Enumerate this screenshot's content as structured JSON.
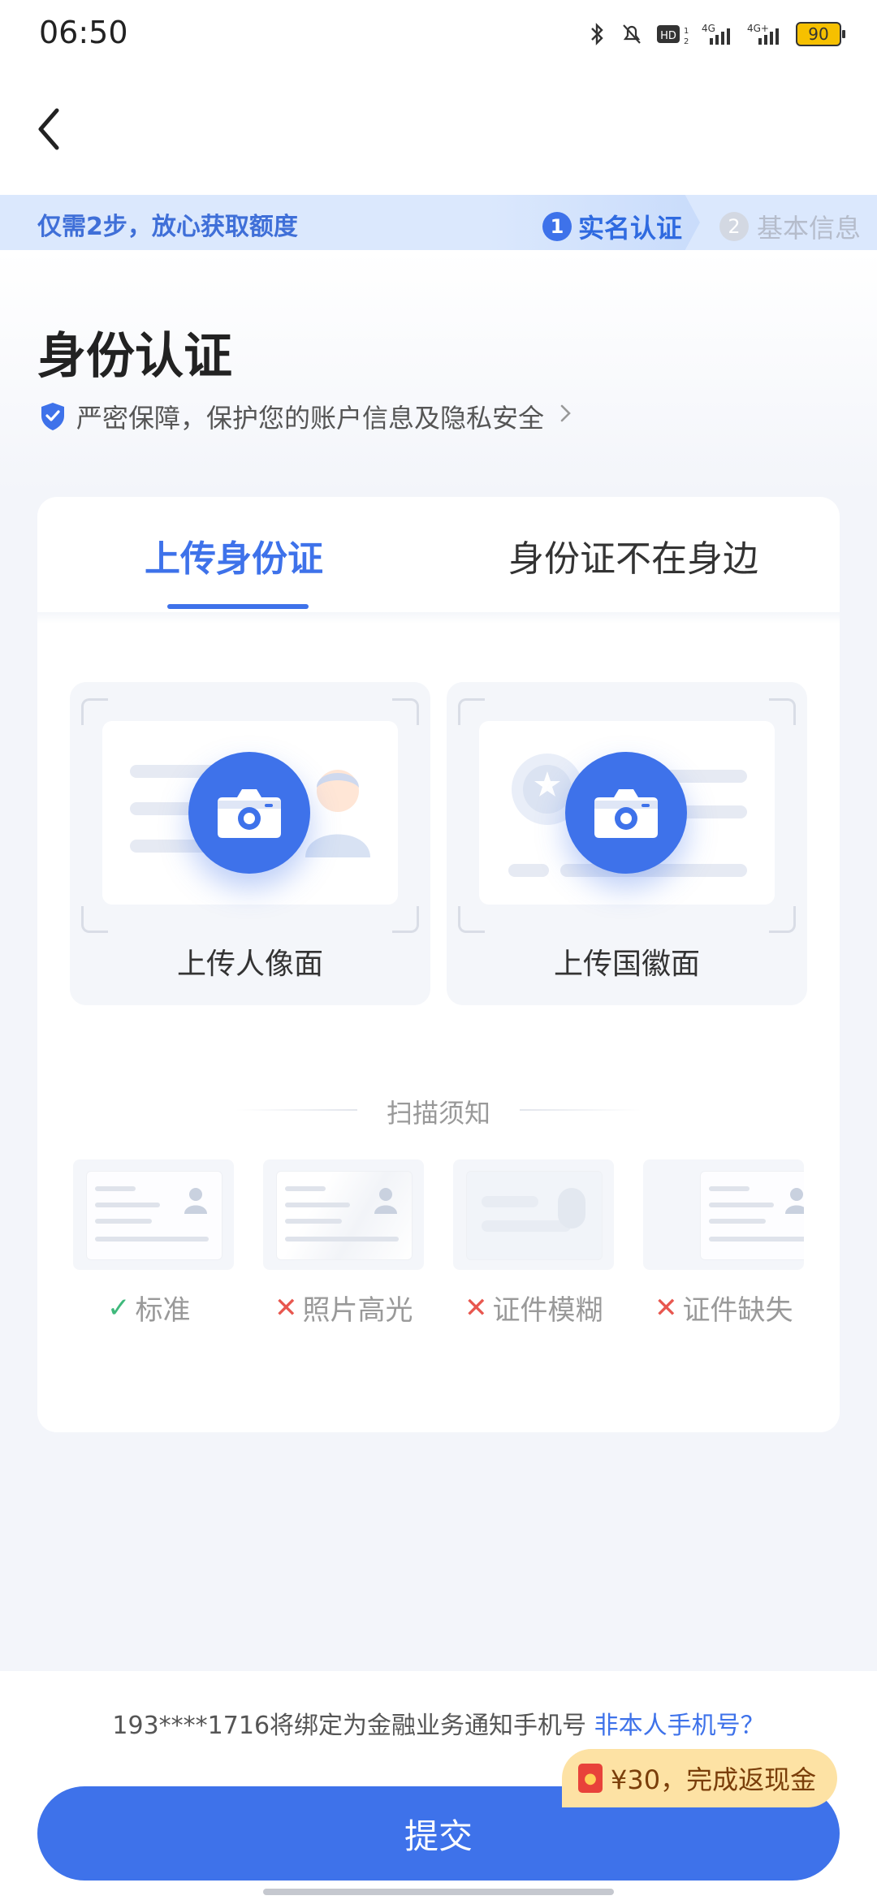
{
  "status_bar": {
    "time": "06:50",
    "battery": "90",
    "net1": "4G",
    "net2": "4G+"
  },
  "banner": {
    "text": "仅需2步，放心获取额度",
    "step1_num": "1",
    "step1_label": "实名认证",
    "step2_num": "2",
    "step2_label": "基本信息"
  },
  "page": {
    "title": "身份认证",
    "secure_text": "严密保障，保护您的账户信息及隐私安全"
  },
  "tabs": [
    {
      "label": "上传身份证",
      "active": true
    },
    {
      "label": "身份证不在身边",
      "active": false
    }
  ],
  "upload": {
    "front_label": "上传人像面",
    "back_label": "上传国徽面"
  },
  "scan_notice": {
    "title": "扫描须知",
    "items": [
      {
        "label": "标准",
        "status": "ok"
      },
      {
        "label": "照片高光",
        "status": "bad"
      },
      {
        "label": "证件模糊",
        "status": "bad"
      },
      {
        "label": "证件缺失",
        "status": "bad"
      }
    ]
  },
  "footer": {
    "phone_text": "193****1716将绑定为金融业务通知手机号",
    "not_my_phone": "非本人手机号？",
    "promo": "¥30，完成返现金",
    "submit": "提交"
  },
  "colors": {
    "primary": "#3e72ea",
    "ok": "#3fb97c",
    "bad": "#e8574f",
    "promo_bg": "#fde2a4"
  }
}
